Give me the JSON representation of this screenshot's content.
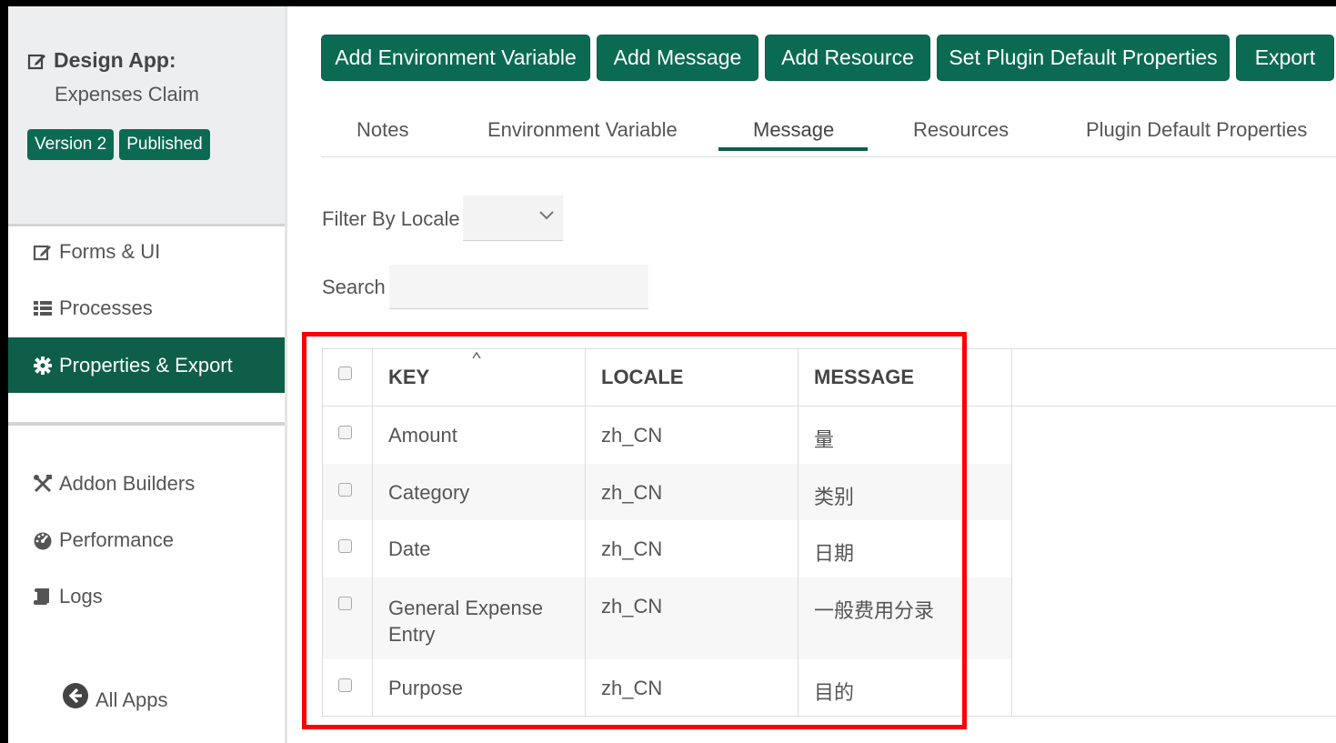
{
  "sidebar": {
    "design_app_label": "Design App:",
    "app_name": "Expenses Claim",
    "badges": [
      "Version 2",
      "Published"
    ],
    "items": [
      {
        "label": "Forms & UI",
        "icon": "edit-icon"
      },
      {
        "label": "Processes",
        "icon": "list-icon"
      },
      {
        "label": "Properties & Export",
        "icon": "gear-icon",
        "active": true
      },
      {
        "label": "Addon Builders",
        "icon": "tools-icon"
      },
      {
        "label": "Performance",
        "icon": "gauge-icon"
      },
      {
        "label": "Logs",
        "icon": "scroll-icon"
      }
    ],
    "all_apps_label": "All Apps"
  },
  "toolbar": {
    "buttons": [
      "Add Environment Variable",
      "Add Message",
      "Add Resource",
      "Set Plugin Default Properties",
      "Export"
    ]
  },
  "tabs": [
    "Notes",
    "Environment Variable",
    "Message",
    "Resources",
    "Plugin Default Properties"
  ],
  "active_tab": "Message",
  "filters": {
    "locale_label": "Filter By Locale",
    "locale_value": "",
    "search_label": "Search",
    "search_value": ""
  },
  "table": {
    "columns": [
      "KEY",
      "LOCALE",
      "MESSAGE"
    ],
    "rows": [
      {
        "key": "Amount",
        "locale": "zh_CN",
        "message": "量"
      },
      {
        "key": "Category",
        "locale": "zh_CN",
        "message": "类别"
      },
      {
        "key": "Date",
        "locale": "zh_CN",
        "message": "日期"
      },
      {
        "key": "General Expense Entry",
        "locale": "zh_CN",
        "message": "一般费用分录"
      },
      {
        "key": "Purpose",
        "locale": "zh_CN",
        "message": "目的"
      }
    ]
  },
  "colors": {
    "brand_green": "#0b6b52",
    "active_nav": "#0e5e49",
    "highlight_red": "#ff0000"
  }
}
